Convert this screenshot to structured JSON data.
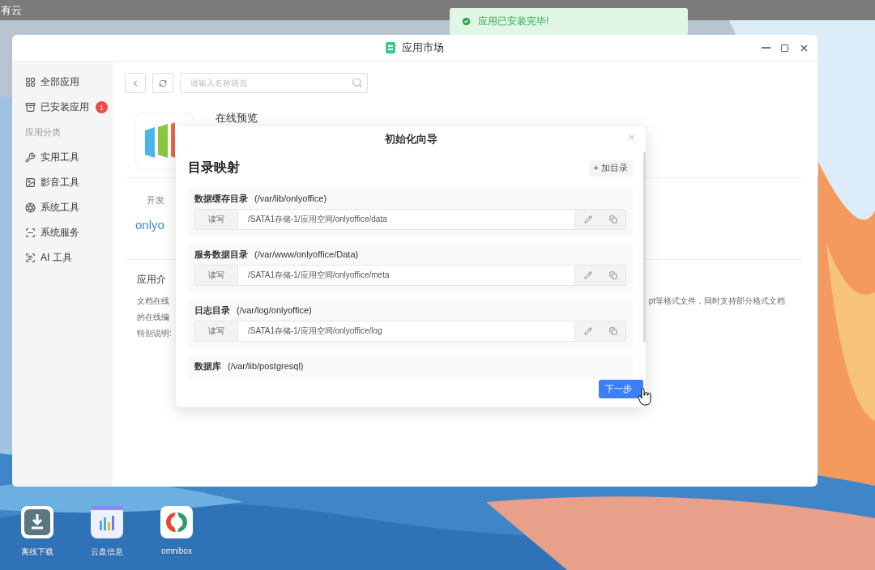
{
  "top_bar": {
    "title": "有云"
  },
  "toast": {
    "message": "应用已安装完毕!"
  },
  "window": {
    "title": "应用市场",
    "sidebar": {
      "groups": [
        {
          "items": [
            {
              "label": "全部应用"
            },
            {
              "label": "已安装应用",
              "badge": "1"
            }
          ]
        },
        {
          "heading": "应用分类",
          "items": [
            {
              "label": "实用工具"
            },
            {
              "label": "影音工具"
            },
            {
              "label": "系统工具"
            },
            {
              "label": "系统服务"
            },
            {
              "label": "AI 工具"
            }
          ]
        }
      ]
    },
    "search": {
      "placeholder": "请输入名称筛选"
    },
    "app": {
      "title": "在线预览",
      "developer_label": "开发",
      "developer": "onlyo",
      "intro_heading": "应用介",
      "description_lines": [
        {
          "left": "文档在线",
          "right": "pt等格式文件，同时支持部分格式文档"
        },
        {
          "left": "的在线编"
        },
        {
          "left": "特别说明:"
        }
      ]
    }
  },
  "dialog": {
    "title": "初始化向导",
    "heading": "目录映射",
    "add_button": "+ 加目录",
    "mappings": [
      {
        "label": "数据缓存目录",
        "path": "(/var/lib/onlyoffice)",
        "mode": "读写",
        "value": "/SATA1存储-1/应用空间/onlyoffice/data"
      },
      {
        "label": "服务数据目录",
        "path": "(/var/www/onlyoffice/Data)",
        "mode": "读写",
        "value": "/SATA1存储-1/应用空间/onlyoffice/meta"
      },
      {
        "label": "日志目录",
        "path": "(/var/log/onlyoffice)",
        "mode": "读写",
        "value": "/SATA1存储-1/应用空间/onlyoffice/log"
      },
      {
        "label": "数据库",
        "path": "(/var/lib/postgresql)"
      }
    ],
    "next_button": "下一步"
  },
  "dock": [
    {
      "label": "离线下载"
    },
    {
      "label": "云盘信息"
    },
    {
      "label": "omnibox"
    }
  ]
}
